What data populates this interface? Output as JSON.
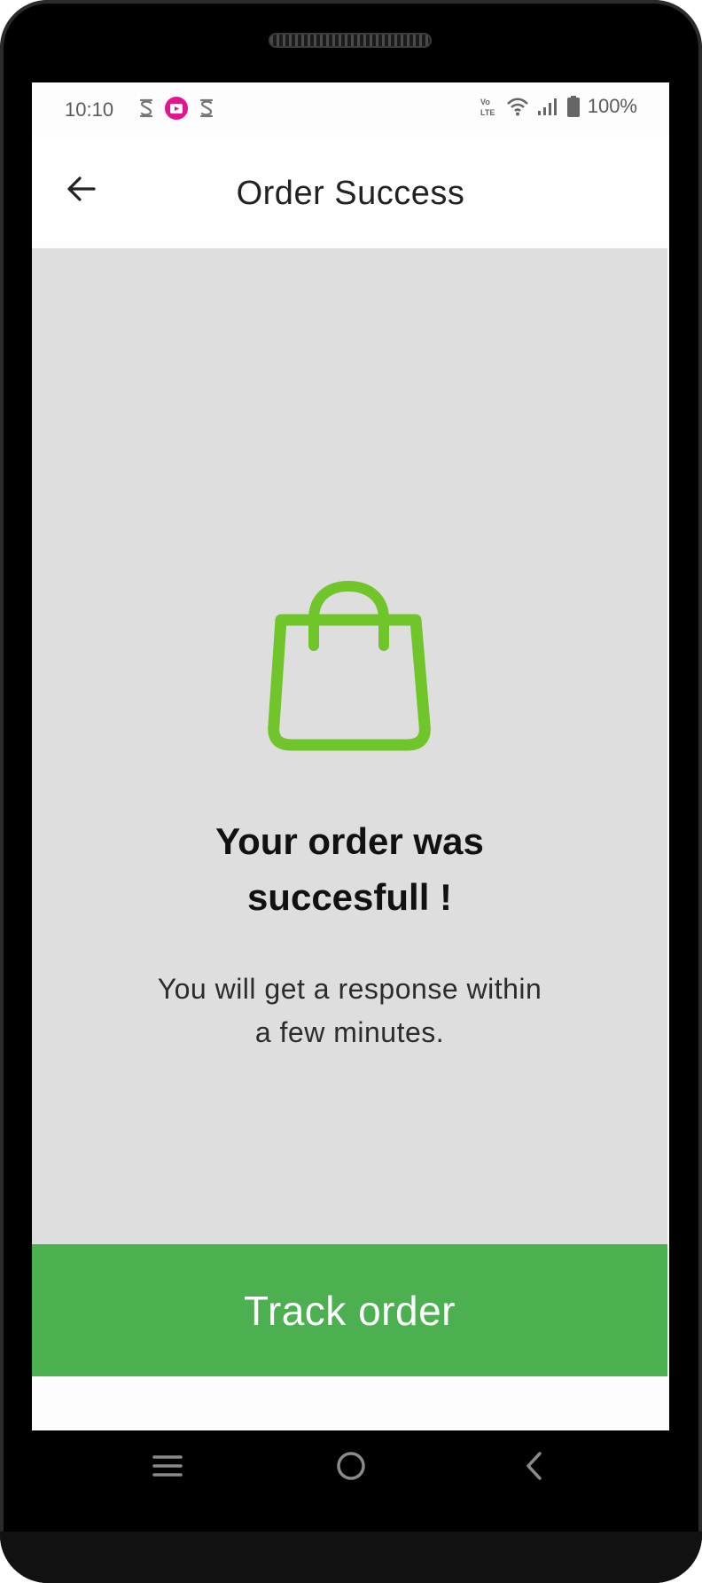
{
  "status_bar": {
    "time": "10:10",
    "battery": "100%",
    "left_icons": [
      "s-app-icon",
      "video-notification-icon",
      "s-app-icon"
    ],
    "right_icons": [
      "volte-icon",
      "wifi-icon",
      "signal-icon",
      "battery-icon"
    ]
  },
  "app_bar": {
    "back_icon": "arrow-left-icon",
    "title": "Order Success"
  },
  "main": {
    "icon": "shopping-bag-icon",
    "headline_line1": "Your order was",
    "headline_line2": "succesfull !",
    "message_line1": "You will get a response within",
    "message_line2": "a few minutes."
  },
  "actions": {
    "track_label": "Track order"
  },
  "nav_bar": {
    "icons": [
      "recent-apps-icon",
      "home-icon",
      "back-icon"
    ]
  },
  "colors": {
    "accent_green": "#4caf50",
    "bag_green": "#6fc52a",
    "content_bg": "#dfdede",
    "notification_pink": "#e2158e"
  }
}
